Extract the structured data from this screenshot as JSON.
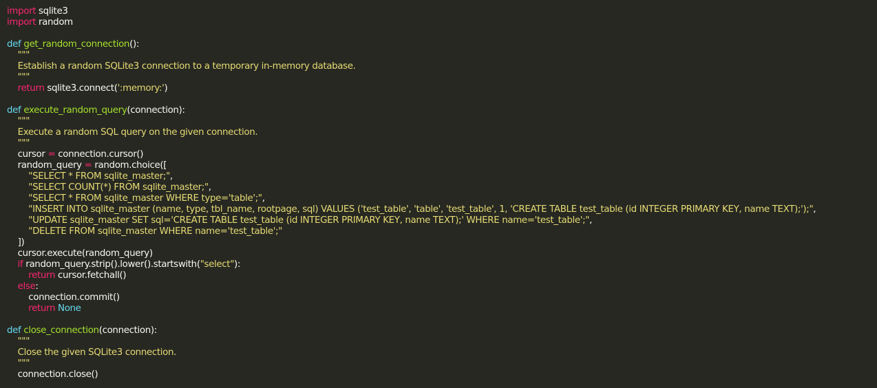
{
  "theme": {
    "background": "#272822",
    "plain": "#f8f8f2",
    "keyword": "#f92672",
    "storage": "#66d9ef",
    "function": "#a6e22e",
    "string": "#e6db74"
  },
  "code": {
    "lines": [
      [
        [
          "import",
          "kw"
        ],
        [
          " sqlite3",
          "plain"
        ]
      ],
      [
        [
          "import",
          "kw"
        ],
        [
          " random",
          "plain"
        ]
      ],
      [],
      [
        [
          "def",
          "def"
        ],
        [
          " ",
          "plain"
        ],
        [
          "get_random_connection",
          "fn"
        ],
        [
          "():",
          "plain"
        ]
      ],
      [
        [
          "    \"\"\"",
          "str"
        ]
      ],
      [
        [
          "    Establish a random SQLite3 connection to a temporary in-memory database.",
          "str"
        ]
      ],
      [
        [
          "    \"\"\"",
          "str"
        ]
      ],
      [
        [
          "    ",
          "plain"
        ],
        [
          "return",
          "kw"
        ],
        [
          " sqlite3.connect(",
          "plain"
        ],
        [
          "':memory:'",
          "str"
        ],
        [
          ")",
          "plain"
        ]
      ],
      [],
      [
        [
          "def",
          "def"
        ],
        [
          " ",
          "plain"
        ],
        [
          "execute_random_query",
          "fn"
        ],
        [
          "(connection):",
          "plain"
        ]
      ],
      [
        [
          "    \"\"\"",
          "str"
        ]
      ],
      [
        [
          "    Execute a random SQL query on the given connection.",
          "str"
        ]
      ],
      [
        [
          "    \"\"\"",
          "str"
        ]
      ],
      [
        [
          "    cursor ",
          "plain"
        ],
        [
          "=",
          "kw"
        ],
        [
          " connection.cursor()",
          "plain"
        ]
      ],
      [
        [
          "    random_query ",
          "plain"
        ],
        [
          "=",
          "kw"
        ],
        [
          " random.choice([",
          "plain"
        ]
      ],
      [
        [
          "        ",
          "plain"
        ],
        [
          "\"SELECT * FROM sqlite_master;\"",
          "str"
        ],
        [
          ",",
          "plain"
        ]
      ],
      [
        [
          "        ",
          "plain"
        ],
        [
          "\"SELECT COUNT(*) FROM sqlite_master;\"",
          "str"
        ],
        [
          ",",
          "plain"
        ]
      ],
      [
        [
          "        ",
          "plain"
        ],
        [
          "\"SELECT * FROM sqlite_master WHERE type='table';\"",
          "str"
        ],
        [
          ",",
          "plain"
        ]
      ],
      [
        [
          "        ",
          "plain"
        ],
        [
          "\"INSERT INTO sqlite_master (name, type, tbl_name, rootpage, sql) VALUES ('test_table', 'table', 'test_table', 1, 'CREATE TABLE test_table (id INTEGER PRIMARY KEY, name TEXT);');\"",
          "str"
        ],
        [
          ",",
          "plain"
        ]
      ],
      [
        [
          "        ",
          "plain"
        ],
        [
          "\"UPDATE sqlite_master SET sql='CREATE TABLE test_table (id INTEGER PRIMARY KEY, name TEXT);' WHERE name='test_table';\"",
          "str"
        ],
        [
          ",",
          "plain"
        ]
      ],
      [
        [
          "        ",
          "plain"
        ],
        [
          "\"DELETE FROM sqlite_master WHERE name='test_table';\"",
          "str"
        ]
      ],
      [
        [
          "    ])",
          "plain"
        ]
      ],
      [
        [
          "    cursor.execute(random_query)",
          "plain"
        ]
      ],
      [
        [
          "    ",
          "plain"
        ],
        [
          "if",
          "kw"
        ],
        [
          " random_query.strip().lower().startswith(",
          "plain"
        ],
        [
          "\"select\"",
          "str"
        ],
        [
          "):",
          "plain"
        ]
      ],
      [
        [
          "        ",
          "plain"
        ],
        [
          "return",
          "kw"
        ],
        [
          " cursor.fetchall()",
          "plain"
        ]
      ],
      [
        [
          "    ",
          "plain"
        ],
        [
          "else",
          "kw"
        ],
        [
          ":",
          "plain"
        ]
      ],
      [
        [
          "        connection.commit()",
          "plain"
        ]
      ],
      [
        [
          "        ",
          "plain"
        ],
        [
          "return",
          "kw"
        ],
        [
          " ",
          "plain"
        ],
        [
          "None",
          "def"
        ]
      ],
      [],
      [
        [
          "def",
          "def"
        ],
        [
          " ",
          "plain"
        ],
        [
          "close_connection",
          "fn"
        ],
        [
          "(connection):",
          "plain"
        ]
      ],
      [
        [
          "    \"\"\"",
          "str"
        ]
      ],
      [
        [
          "    Close the given SQLite3 connection.",
          "str"
        ]
      ],
      [
        [
          "    \"\"\"",
          "str"
        ]
      ],
      [
        [
          "    connection.close()",
          "plain"
        ]
      ]
    ]
  }
}
